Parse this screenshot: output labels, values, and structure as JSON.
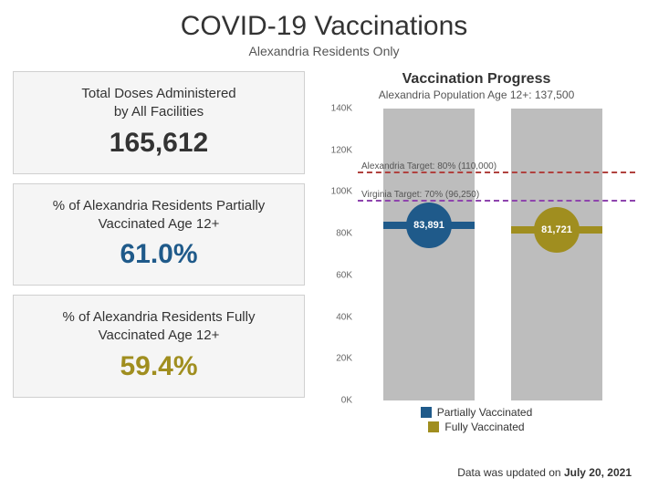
{
  "title": "COVID-19 Vaccinations",
  "subtitle": "Alexandria Residents Only",
  "cards": {
    "doses": {
      "line1": "Total Doses Administered",
      "line2": "by All Facilities",
      "value": "165,612"
    },
    "partial": {
      "line1": "% of Alexandria Residents Partially",
      "line2": "Vaccinated Age 12+",
      "value": "61.0%"
    },
    "fully": {
      "line1": "% of Alexandria Residents Fully",
      "line2": "Vaccinated Age 12+",
      "value": "59.4%"
    }
  },
  "chart": {
    "title": "Vaccination Progress",
    "subtitle": "Alexandria Population Age 12+: 137,500",
    "yticks": [
      "0K",
      "20K",
      "40K",
      "60K",
      "80K",
      "100K",
      "120K",
      "140K"
    ],
    "targets": {
      "alexandria": {
        "label": "Alexandria Target: 80% (110,000)",
        "value": 110000
      },
      "virginia": {
        "label": "Virginia Target: 70% (96,250)",
        "value": 96250
      }
    },
    "legend": {
      "partial": "Partially Vaccinated",
      "fully": "Fully Vaccinated"
    },
    "bars": {
      "partial": {
        "value": 83891,
        "label": "83,891"
      },
      "fully": {
        "value": 81721,
        "label": "81,721"
      }
    }
  },
  "footer": {
    "prefix": "Data was updated on ",
    "date": "July 20, 2021"
  },
  "chart_data": {
    "type": "bar",
    "title": "Vaccination Progress",
    "subtitle": "Alexandria Population Age 12+: 137,500",
    "categories": [
      "Partially Vaccinated",
      "Fully Vaccinated"
    ],
    "values": [
      83891,
      81721
    ],
    "ylim": [
      0,
      140000
    ],
    "xlabel": "",
    "ylabel": "",
    "reference_lines": [
      {
        "label": "Alexandria Target: 80% (110,000)",
        "value": 110000
      },
      {
        "label": "Virginia Target: 70% (96,250)",
        "value": 96250
      }
    ],
    "background_bar_max": 140000
  }
}
